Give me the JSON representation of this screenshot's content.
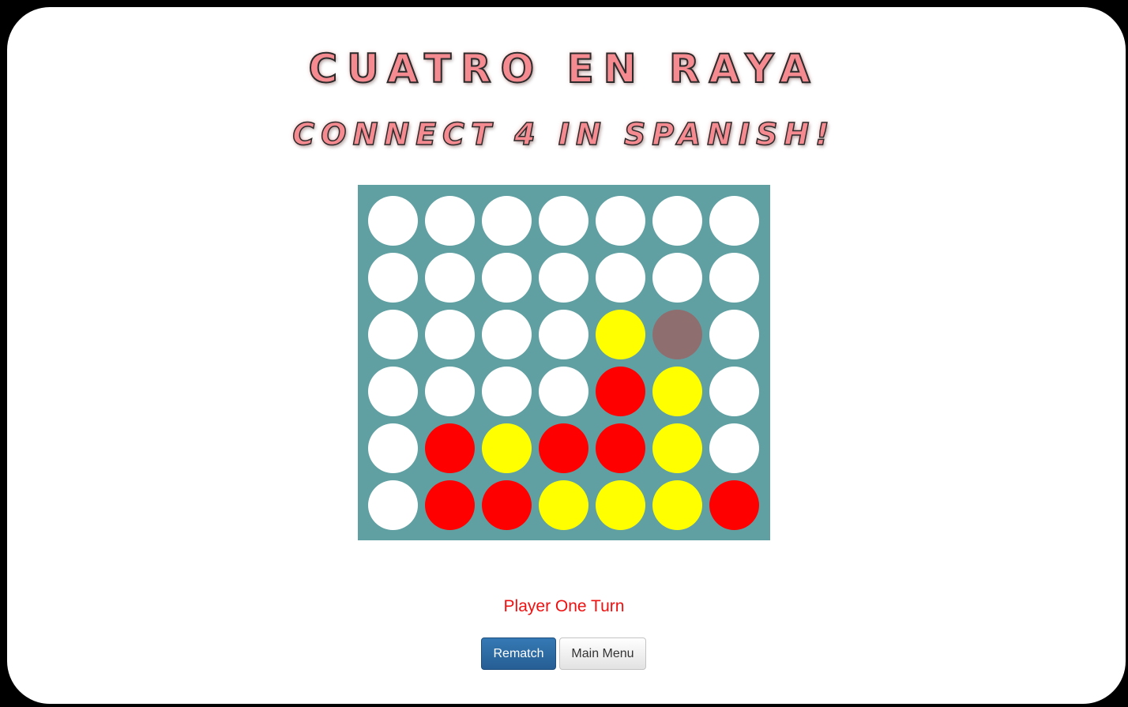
{
  "title": "CUATRO EN RAYA",
  "subtitle": "CONNECT 4 IN SPANISH!",
  "board": {
    "rows": 6,
    "cols": 7,
    "background": "#61a0a2",
    "piece_colors": {
      "empty": "#ffffff",
      "red": "#ff0000",
      "yellow": "#ffff00",
      "hover": "#8f6e70"
    },
    "cells": [
      [
        "empty",
        "empty",
        "empty",
        "empty",
        "empty",
        "empty",
        "empty"
      ],
      [
        "empty",
        "empty",
        "empty",
        "empty",
        "empty",
        "empty",
        "empty"
      ],
      [
        "empty",
        "empty",
        "empty",
        "empty",
        "yellow",
        "hover",
        "empty"
      ],
      [
        "empty",
        "empty",
        "empty",
        "empty",
        "red",
        "yellow",
        "empty"
      ],
      [
        "empty",
        "red",
        "yellow",
        "red",
        "red",
        "yellow",
        "empty"
      ],
      [
        "empty",
        "red",
        "red",
        "yellow",
        "yellow",
        "yellow",
        "red"
      ]
    ]
  },
  "status": {
    "turn_text": "Player One Turn",
    "color": "#ee1111"
  },
  "buttons": {
    "rematch_label": "Rematch",
    "main_menu_label": "Main Menu"
  }
}
